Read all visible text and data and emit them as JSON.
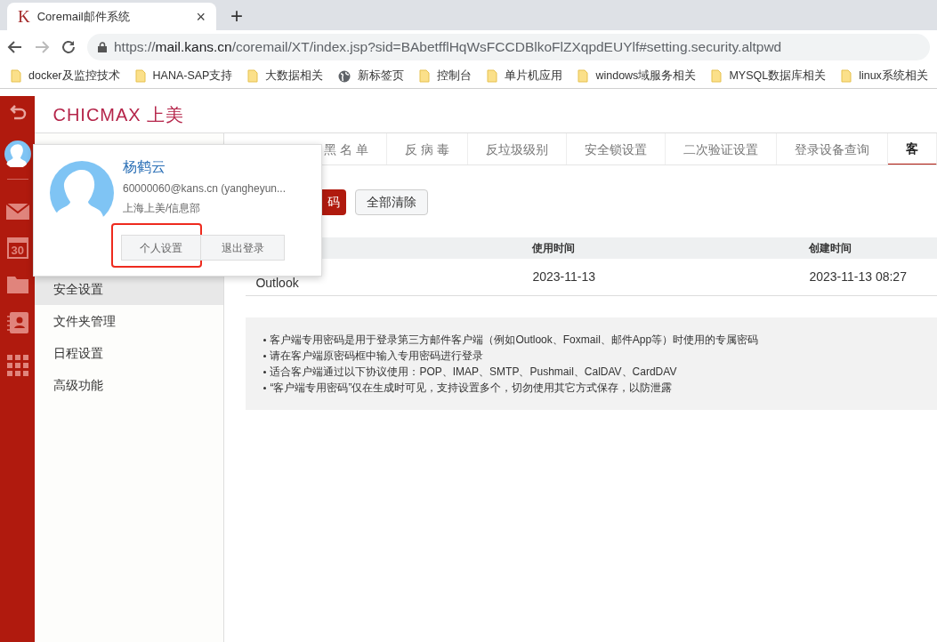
{
  "browser": {
    "tab": {
      "logo": "K",
      "title": "Coremail邮件系统",
      "close": "×",
      "new_tab": "+"
    },
    "address": {
      "scheme": "https://",
      "host": "mail.kans.cn",
      "path": "/coremail/XT/index.jsp?sid=BAbetfflHqWsFCCDBlkoFlZXqpdEUYlf#setting.security.altpwd"
    },
    "bookmarks": [
      {
        "kind": "folder",
        "label": "docker及监控技术"
      },
      {
        "kind": "folder",
        "label": "HANA-SAP支持"
      },
      {
        "kind": "folder",
        "label": "大数据相关"
      },
      {
        "kind": "globe",
        "label": "新标签页"
      },
      {
        "kind": "folder",
        "label": "控制台"
      },
      {
        "kind": "folder",
        "label": "单片机应用"
      },
      {
        "kind": "folder",
        "label": "windows域服务相关"
      },
      {
        "kind": "folder",
        "label": "MYSQL数据库相关"
      },
      {
        "kind": "folder",
        "label": "linux系统相关"
      }
    ]
  },
  "rail": {
    "calendar_day": "30"
  },
  "logo": {
    "brand": "CHICMAX",
    "suffix": "上美"
  },
  "settings_menu": [
    {
      "label": "安全设置",
      "selected": true
    },
    {
      "label": "文件夹管理",
      "selected": false
    },
    {
      "label": "日程设置",
      "selected": false
    },
    {
      "label": "高级功能",
      "selected": false
    }
  ],
  "tabs": [
    {
      "label": "黑 名 单",
      "selected": false
    },
    {
      "label": "反 病 毒",
      "selected": false
    },
    {
      "label": "反垃圾级别",
      "selected": false
    },
    {
      "label": "安全锁设置",
      "selected": false
    },
    {
      "label": "二次验证设置",
      "selected": false
    },
    {
      "label": "登录设备查询",
      "selected": false
    },
    {
      "label": "客",
      "selected": true
    }
  ],
  "actions": {
    "primary": "码",
    "secondary": "全部清除"
  },
  "table": {
    "columns": [
      "使用时间",
      "创建时间"
    ],
    "rows": [
      {
        "column_1": "Outlook",
        "used": "2023-11-13",
        "created": "2023-11-13 08:27"
      }
    ]
  },
  "notes": [
    "客户端专用密码是用于登录第三方邮件客户端（例如Outlook、Foxmail、邮件App等）时使用的专属密码",
    "请在客户端原密码框中输入专用密码进行登录",
    "适合客户端通过以下协议使用：POP、IMAP、SMTP、Pushmail、CalDAV、CardDAV",
    "“客户端专用密码”仅在生成时可见，支持设置多个，切勿使用其它方式保存，以防泄露"
  ],
  "profile_popup": {
    "name": "杨鹤云",
    "email": "60000060@kans.cn (yangheyun...",
    "department": "上海上美/信息部",
    "buttons": [
      {
        "label": "个人设置",
        "highlighted": true
      },
      {
        "label": "退出登录",
        "highlighted": false
      }
    ]
  }
}
